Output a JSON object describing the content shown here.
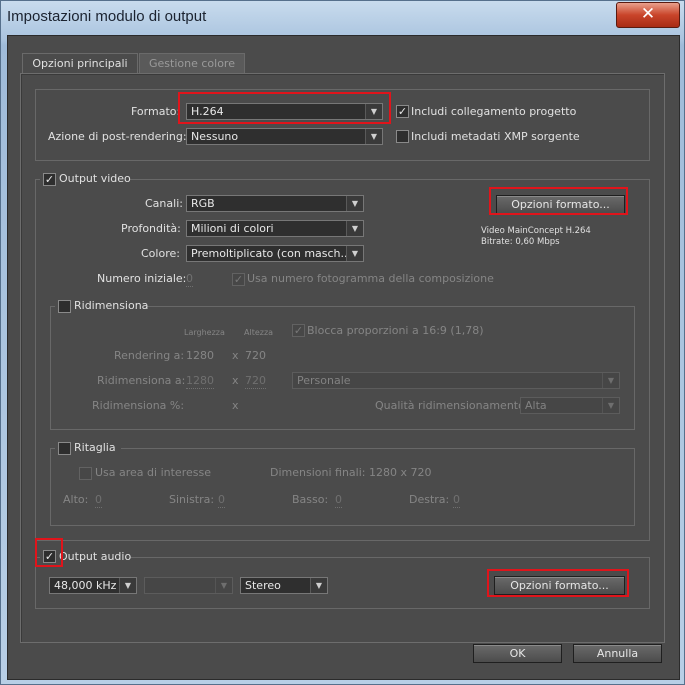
{
  "window": {
    "title": "Impostazioni modulo di output",
    "close_glyph": "✕"
  },
  "tabs": [
    {
      "label": "Opzioni principali",
      "active": true
    },
    {
      "label": "Gestione colore",
      "active": false
    }
  ],
  "top": {
    "format_label": "Formato:",
    "format_value": "H.264",
    "post_label": "Azione di post-rendering:",
    "post_value": "Nessuno",
    "include_project_link": "Includi collegamento progetto",
    "include_xmp": "Includi metadati XMP sorgente",
    "checked": "✓"
  },
  "video": {
    "header": "Output video",
    "channels_label": "Canali:",
    "channels_value": "RGB",
    "depth_label": "Profondità:",
    "depth_value": "Milioni di colori",
    "color_label": "Colore:",
    "color_value": "Premoltiplicato (con masch...",
    "start_label": "Numero iniziale:",
    "start_value": "0",
    "use_comp_frame": "Usa numero fotogramma della composizione",
    "format_options": "Opzioni formato...",
    "info_line1": "Video MainConcept H.264",
    "info_line2": "Bitrate: 0,60 Mbps"
  },
  "resize": {
    "header": "Ridimensiona",
    "width_hdr": "Larghezza",
    "height_hdr": "Altezza",
    "lock_aspect": "Blocca proporzioni a 16:9 (1,78)",
    "rendering_label": "Rendering a:",
    "rendering_w": "1280",
    "x": "x",
    "rendering_h": "720",
    "resize_label": "Ridimensiona a:",
    "resize_w": "1280",
    "resize_h": "720",
    "preset_value": "Personale",
    "percent_label": "Ridimensiona %:",
    "quality_label": "Qualità ridimensionamento:",
    "quality_value": "Alta"
  },
  "crop": {
    "header": "Ritaglia",
    "use_roi": "Usa area di interesse",
    "final_dims": "Dimensioni finali: 1280 x 720",
    "top_label": "Alto:",
    "top_value": "0",
    "left_label": "Sinistra:",
    "left_value": "0",
    "bottom_label": "Basso:",
    "bottom_value": "0",
    "right_label": "Destra:",
    "right_value": "0"
  },
  "audio": {
    "header": "Output audio",
    "rate_value": "48,000 kHz",
    "bits_value": "",
    "channels_value": "Stereo",
    "format_options": "Opzioni formato..."
  },
  "footer": {
    "ok": "OK",
    "cancel": "Annulla"
  },
  "arrow_glyph": "▼",
  "highlight_color": "#e0141b"
}
